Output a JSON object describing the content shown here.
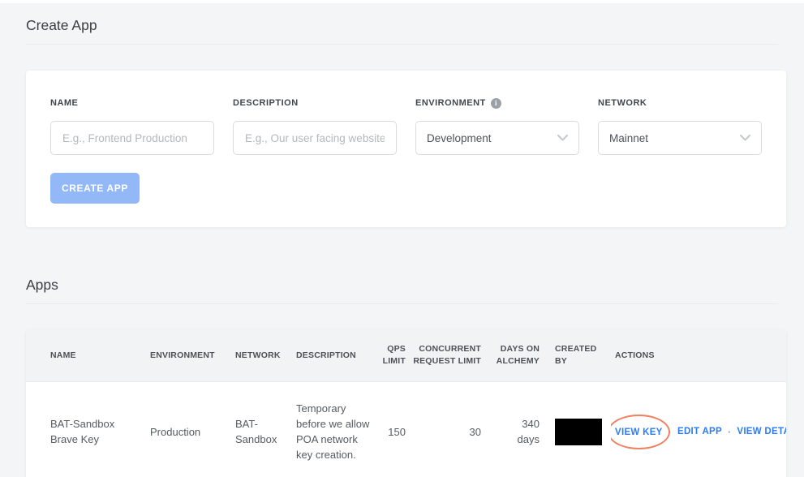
{
  "create_app": {
    "title": "Create App",
    "form": {
      "name": {
        "label": "NAME",
        "placeholder": "E.g., Frontend Production"
      },
      "description": {
        "label": "DESCRIPTION",
        "placeholder": "E.g., Our user facing website"
      },
      "environment": {
        "label": "ENVIRONMENT",
        "value": "Development",
        "info_icon_glyph": "i"
      },
      "network": {
        "label": "NETWORK",
        "value": "Mainnet"
      },
      "submit_label": "CREATE APP"
    }
  },
  "apps": {
    "title": "Apps",
    "table": {
      "columns": [
        "NAME",
        "ENVIRONMENT",
        "NETWORK",
        "DESCRIPTION",
        "QPS LIMIT",
        "CONCURRENT REQUEST LIMIT",
        "DAYS ON ALCHEMY",
        "CREATED BY",
        "ACTIONS"
      ],
      "action_separator": "·",
      "rows": [
        {
          "name": "BAT-Sandbox Brave Key",
          "environment": "Production",
          "network": "BAT-Sandbox",
          "description": "Temporary before we allow POA network key creation.",
          "qps_limit": "150",
          "concurrent_request_limit": "30",
          "days_on_alchemy": "340 days",
          "created_by_redacted": true,
          "actions": [
            "VIEW KEY",
            "EDIT APP",
            "VIEW DETAILS"
          ]
        }
      ]
    }
  },
  "annotations": {
    "view_key_highlight": {
      "shape": "ellipse",
      "color": "#EE8263",
      "target": "VIEW KEY"
    }
  },
  "colors": {
    "page_background": "#F4F5F6",
    "card_background": "#FFFFFF",
    "primary_button": "#92B8F8",
    "link_blue": "#2C7CF7",
    "table_header_background": "#F2F3F4",
    "annotation": "#EE8263",
    "redaction": "#000000"
  }
}
